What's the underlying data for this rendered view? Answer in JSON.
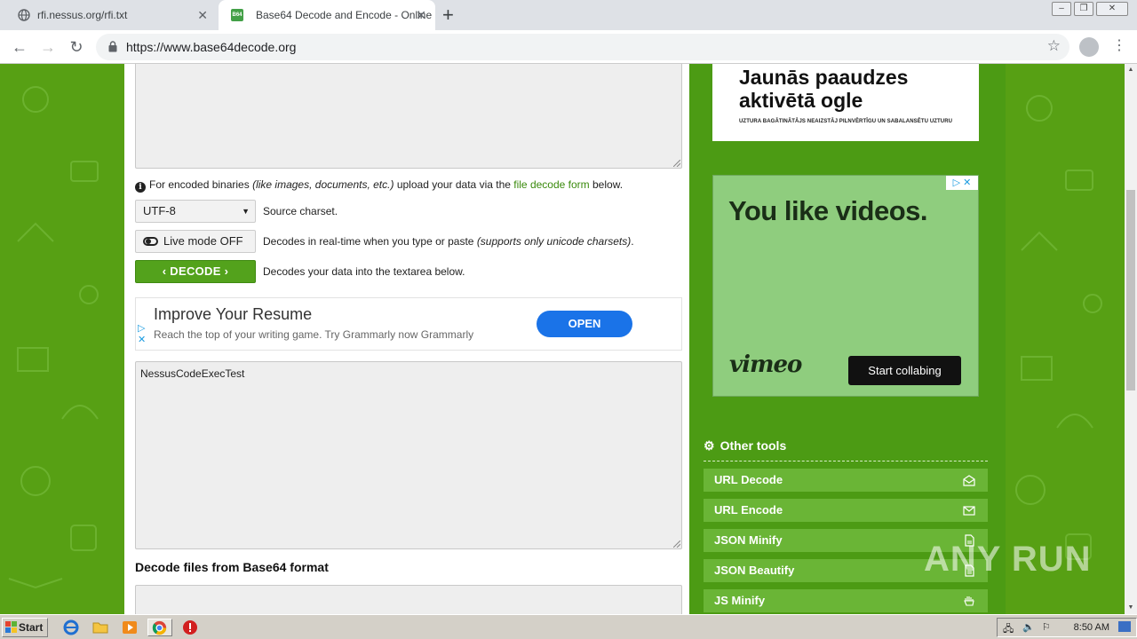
{
  "browser": {
    "tabs": [
      {
        "title": "rfi.nessus.org/rfi.txt"
      },
      {
        "title": "Base64 Decode and Encode - Online",
        "favicon_text": "B64"
      }
    ],
    "url": "https://www.base64decode.org"
  },
  "decoder": {
    "info_prefix": "For encoded binaries",
    "info_italic": "(like images, documents, etc.)",
    "info_mid": "upload your data via the",
    "info_link": "file decode form",
    "info_suffix": "below.",
    "charset_value": "UTF-8",
    "charset_desc": "Source charset.",
    "live_mode_label": "Live mode OFF",
    "live_desc_prefix": "Decodes in real-time when you type or paste",
    "live_desc_italic": "(supports only unicode charsets)",
    "live_desc_suffix": ".",
    "decode_label": "DECODE",
    "decode_desc": "Decodes your data into the textarea below.",
    "output_text": "NessusCodeExecTest",
    "files_section_title": "Decode files from Base64 format"
  },
  "ad_resume": {
    "title": "Improve Your Resume",
    "subtitle": "Reach the top of your writing game. Try Grammarly now Grammarly",
    "button": "OPEN"
  },
  "ad_ogle": {
    "line1a": "Jaunās paaudzes",
    "line1b": "aktivētā ogle",
    "line2": "UZTURA BAGĀTINĀTĀJS NEAIZSTĀJ PILNVĒRTĪGU UN SABALANSĒTU UZTURU"
  },
  "ad_vimeo": {
    "headline": "You like videos.",
    "brand": "vimeo",
    "cta": "Start collabing"
  },
  "sidebar": {
    "tools_title": "Other tools",
    "tools": [
      {
        "label": "URL Decode",
        "icon": "envelope-open-icon"
      },
      {
        "label": "URL Encode",
        "icon": "envelope-icon"
      },
      {
        "label": "JSON Minify",
        "icon": "file-icon"
      },
      {
        "label": "JSON Beautify",
        "icon": "file-icon"
      },
      {
        "label": "JS Minify",
        "icon": "hand-icon"
      }
    ]
  },
  "watermark": "ANY RUN",
  "taskbar": {
    "start_label": "Start",
    "clock": "8:50 AM"
  },
  "colors": {
    "page_green": "#57a014",
    "sidebar_green": "#4c9b14",
    "tool_green": "#6ab536",
    "link_green": "#3a8a0c",
    "open_button_blue": "#1a73e8"
  }
}
